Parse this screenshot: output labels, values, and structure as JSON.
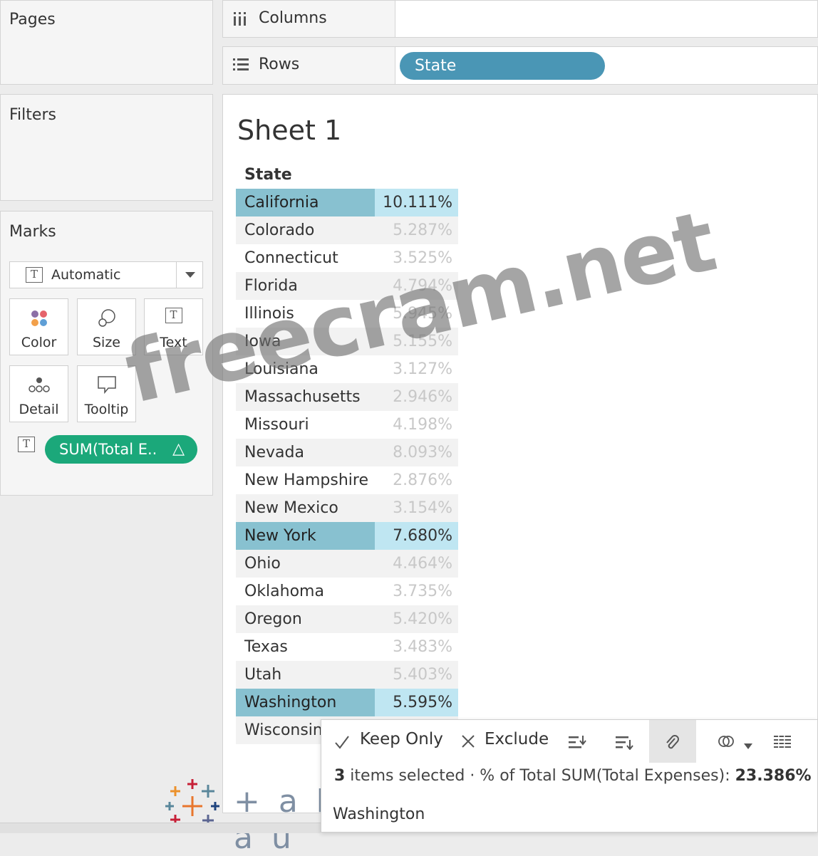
{
  "left_panels": {
    "pages_title": "Pages",
    "filters_title": "Filters",
    "marks_title": "Marks",
    "mark_type": "Automatic",
    "mark_buttons": [
      {
        "label": "Color",
        "icon": "color-icon"
      },
      {
        "label": "Size",
        "icon": "size-icon"
      },
      {
        "label": "Text",
        "icon": "text-icon"
      },
      {
        "label": "Detail",
        "icon": "detail-icon"
      },
      {
        "label": "Tooltip",
        "icon": "tooltip-icon"
      }
    ],
    "measure_pill": "SUM(Total E..",
    "measure_pill_delta": "△"
  },
  "shelves": {
    "columns_label": "Columns",
    "rows_label": "Rows",
    "rows_pill": "State"
  },
  "sheet": {
    "title": "Sheet 1",
    "column_header": "State",
    "rows": [
      {
        "name": "California",
        "value": "10.111%",
        "selected": true
      },
      {
        "name": "Colorado",
        "value": "5.287%",
        "selected": false
      },
      {
        "name": "Connecticut",
        "value": "3.525%",
        "selected": false
      },
      {
        "name": "Florida",
        "value": "4.794%",
        "selected": false
      },
      {
        "name": "Illinois",
        "value": "5.945%",
        "selected": false
      },
      {
        "name": "Iowa",
        "value": "5.155%",
        "selected": false
      },
      {
        "name": "Louisiana",
        "value": "3.127%",
        "selected": false
      },
      {
        "name": "Massachusetts",
        "value": "2.946%",
        "selected": false
      },
      {
        "name": "Missouri",
        "value": "4.198%",
        "selected": false
      },
      {
        "name": "Nevada",
        "value": "8.093%",
        "selected": false
      },
      {
        "name": "New Hampshire",
        "value": "2.876%",
        "selected": false
      },
      {
        "name": "New Mexico",
        "value": "3.154%",
        "selected": false
      },
      {
        "name": "New York",
        "value": "7.680%",
        "selected": true
      },
      {
        "name": "Ohio",
        "value": "4.464%",
        "selected": false
      },
      {
        "name": "Oklahoma",
        "value": "3.735%",
        "selected": false
      },
      {
        "name": "Oregon",
        "value": "5.420%",
        "selected": false
      },
      {
        "name": "Texas",
        "value": "3.483%",
        "selected": false
      },
      {
        "name": "Utah",
        "value": "5.403%",
        "selected": false
      },
      {
        "name": "Washington",
        "value": "5.595%",
        "selected": true
      },
      {
        "name": "Wisconsin",
        "value": "",
        "selected": false
      }
    ]
  },
  "action_bar": {
    "keep_only": "Keep Only",
    "exclude": "Exclude",
    "count": "3",
    "summary_text": " items selected  ·  % of Total SUM(Total Expenses): ",
    "summary_value": "23.386%",
    "hover_item": "Washington"
  },
  "watermark": "freecram.net",
  "logo_text": "+ a b l e a u",
  "colors": {
    "selected_name_bg": "#88c1d0",
    "selected_value_bg": "#bfe6f2",
    "state_pill": "#4a96b5",
    "measure_pill": "#1ba87a"
  }
}
